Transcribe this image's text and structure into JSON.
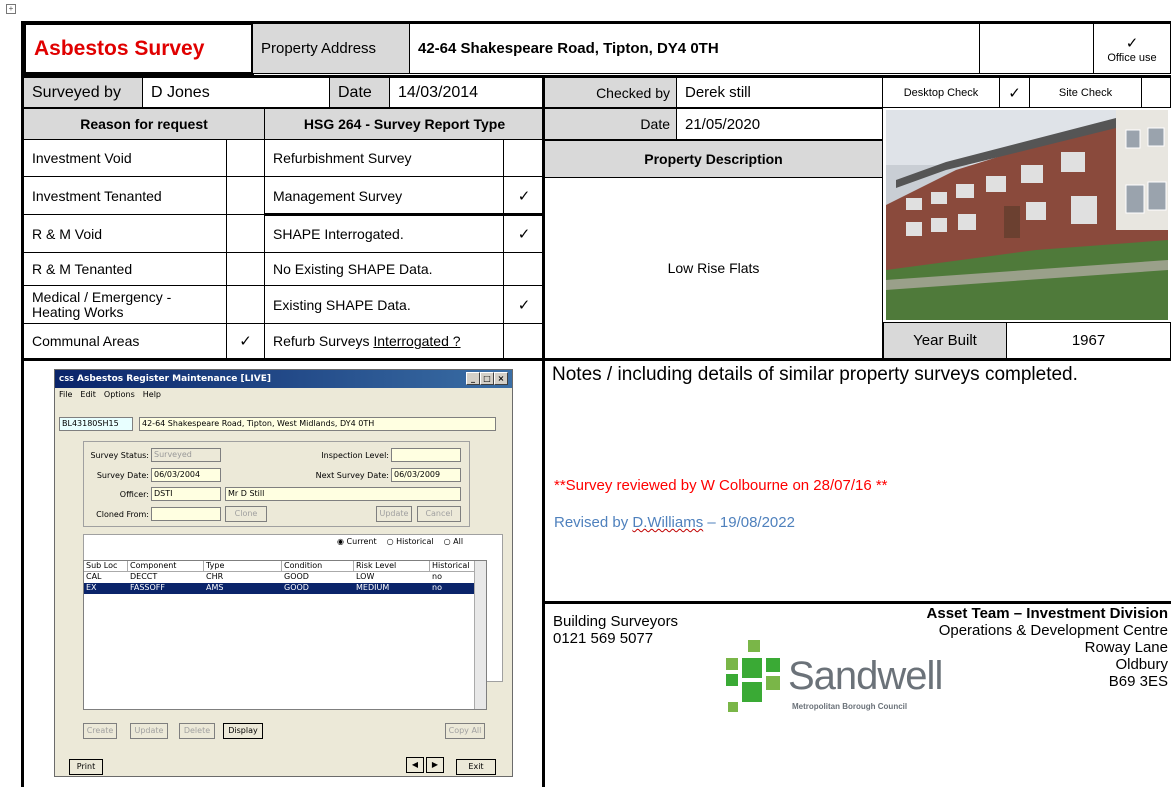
{
  "header": {
    "title": "Asbestos Survey",
    "property_address_label": "Property Address",
    "property_address": "42-64 Shakespeare Road, Tipton, DY4 0TH",
    "office_use_tick": "✓",
    "office_use_label": "Office use"
  },
  "survey_info": {
    "surveyed_by_label": "Surveyed by",
    "surveyed_by": "D Jones",
    "date_label": "Date",
    "date": "14/03/2014",
    "checked_by_label": "Checked by",
    "checked_by": "Derek still",
    "desktop_check_label": "Desktop Check",
    "desktop_check_tick": "✓",
    "site_check_label": "Site Check",
    "check_date_label": "Date",
    "check_date": "21/05/2020"
  },
  "reason_for_request": {
    "heading": "Reason for request",
    "items": [
      {
        "label": "Investment Void",
        "tick": ""
      },
      {
        "label": "Investment Tenanted",
        "tick": ""
      },
      {
        "label": "R & M Void",
        "tick": ""
      },
      {
        "label": "R & M Tenanted",
        "tick": ""
      },
      {
        "label": "Medical / Emergency - Heating Works",
        "tick": ""
      },
      {
        "label": "Communal Areas",
        "tick": "✓"
      }
    ]
  },
  "survey_report_type": {
    "heading": "HSG 264 - Survey Report Type",
    "items": [
      {
        "label": "Refurbishment Survey",
        "tick": ""
      },
      {
        "label": "Management Survey",
        "tick": "✓"
      },
      {
        "label": "SHAPE Interrogated.",
        "tick": "✓"
      },
      {
        "label": "No Existing SHAPE Data.",
        "tick": ""
      },
      {
        "label": "Existing SHAPE Data.",
        "tick": "✓"
      }
    ],
    "refurb_prefix": "Refurb Surveys ",
    "refurb_link": "Interrogated ?"
  },
  "property_description": {
    "heading": "Property Description",
    "value": "Low Rise Flats"
  },
  "year_built": {
    "label": "Year Built",
    "value": "1967"
  },
  "register_window": {
    "title": "Asbestos Register Maintenance [LIVE]",
    "app_prefix": "CSS",
    "menu": [
      "File",
      "Edit",
      "Options",
      "Help"
    ],
    "ref": "BL43180SH15",
    "address": "42-64 Shakespeare Road, Tipton, West Midlands, DY4 0TH",
    "survey_status_label": "Survey Status:",
    "survey_status": "Surveyed",
    "inspection_level_label": "Inspection Level:",
    "inspection_level": "",
    "survey_date_label": "Survey Date:",
    "survey_date": "06/03/2004",
    "next_survey_date_label": "Next Survey Date:",
    "next_survey_date": "06/03/2009",
    "officer_label": "Officer:",
    "officer_code": "DSTI",
    "officer_name": "Mr D Still",
    "cloned_from_label": "Cloned From:",
    "cloned_from": "",
    "clone_button": "Clone",
    "update_button": "Update",
    "cancel_button": "Cancel",
    "radio_current": "Current",
    "radio_historical": "Historical",
    "radio_all": "All",
    "columns": [
      "Sub Loc",
      "Component",
      "Type",
      "Condition",
      "Risk Level",
      "Historical"
    ],
    "rows": [
      [
        "CAL",
        "DECCT",
        "CHR",
        "GOOD",
        "LOW",
        "no"
      ],
      [
        "EX",
        "FASSOFF",
        "AMS",
        "GOOD",
        "MEDIUM",
        "no"
      ]
    ],
    "create_button": "Create",
    "update2_button": "Update",
    "delete_button": "Delete",
    "display_button": "Display",
    "copy_all_button": "Copy All",
    "print_button": "Print",
    "exit_button": "Exit"
  },
  "notes": {
    "heading_main": "Notes",
    "heading_rest": " / including details of similar property surveys completed.",
    "review_note": "**Survey reviewed by W Colbourne on 28/07/16 **",
    "revised_prefix": "Revised by ",
    "revised_name": "D.Williams",
    "revised_suffix": " – 19/08/2022"
  },
  "contacts": {
    "left_line1": "Building Surveyors",
    "left_line2": "0121 569 5077",
    "team": "Asset Team – Investment Division",
    "address_line1": "Operations & Development Centre",
    "address_line2": "Roway Lane",
    "address_line3": "Oldbury",
    "address_line4": "B69 3ES"
  },
  "logo": {
    "name": "Sandwell",
    "subtitle": "Metropolitan Borough Council",
    "color": "#3aaa35"
  },
  "colors": {
    "title_red": "#e00000",
    "header_grey": "#d9d9d9",
    "revised_blue": "#4f81bd"
  }
}
